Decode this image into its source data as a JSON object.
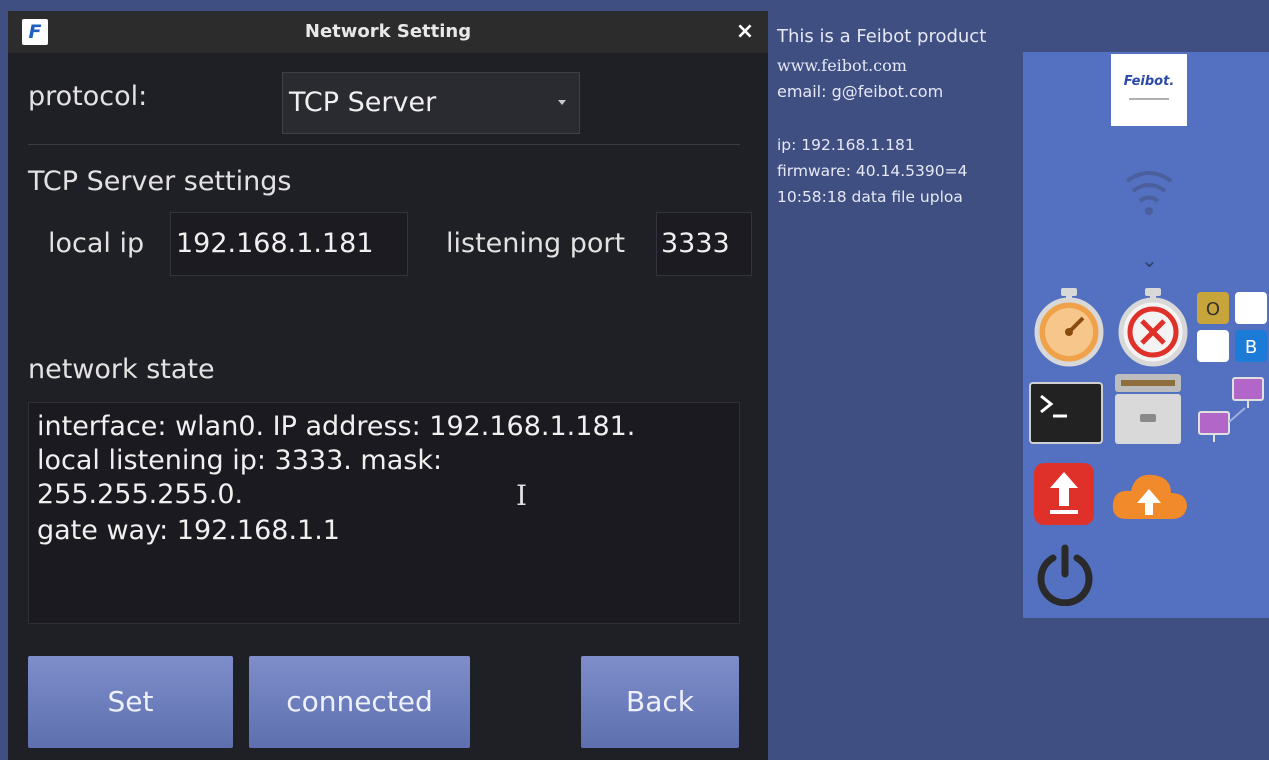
{
  "window": {
    "title": "Network Setting",
    "logo_letter": "F",
    "close_symbol": "×"
  },
  "form": {
    "protocol_label": "protocol:",
    "protocol_value": "TCP Server",
    "section_title": "TCP Server settings",
    "local_ip_label": "local ip",
    "local_ip_value": "192.168.1.181",
    "port_label": "listening port",
    "port_value": "3333",
    "state_label": "network state",
    "state_lines": [
      "interface: wlan0.   IP address: 192.168.1.181.",
      "local listening ip: 3333.   mask:",
      "255.255.255.0.",
      "gate way: 192.168.1.1"
    ]
  },
  "buttons": {
    "set": "Set",
    "connected": "connected",
    "back": "Back"
  },
  "info": {
    "product": "This is a Feibot product",
    "website": "www.feibot.com",
    "email": "email: g@feibot.com",
    "ip": "ip: 192.168.1.181",
    "firmware": "firmware: 40.14.5390=4",
    "log": "10:58:18 data file uploa"
  },
  "panel": {
    "brand": "Feibot.",
    "ob_labels": [
      "O",
      "B"
    ],
    "icons": [
      "wifi-icon",
      "chevron-down-icon",
      "stopwatch-icon",
      "stopwatch-cancel-icon",
      "terminal-icon",
      "file-cabinet-icon",
      "remote-desktop-icon",
      "upload-icon",
      "cloud-upload-icon",
      "power-icon"
    ]
  },
  "colors": {
    "dialog_bg": "#1f1f26",
    "desktop_bg": "#3f4f82",
    "panel_bg": "#5470c0",
    "button": "#6b7cbc"
  }
}
